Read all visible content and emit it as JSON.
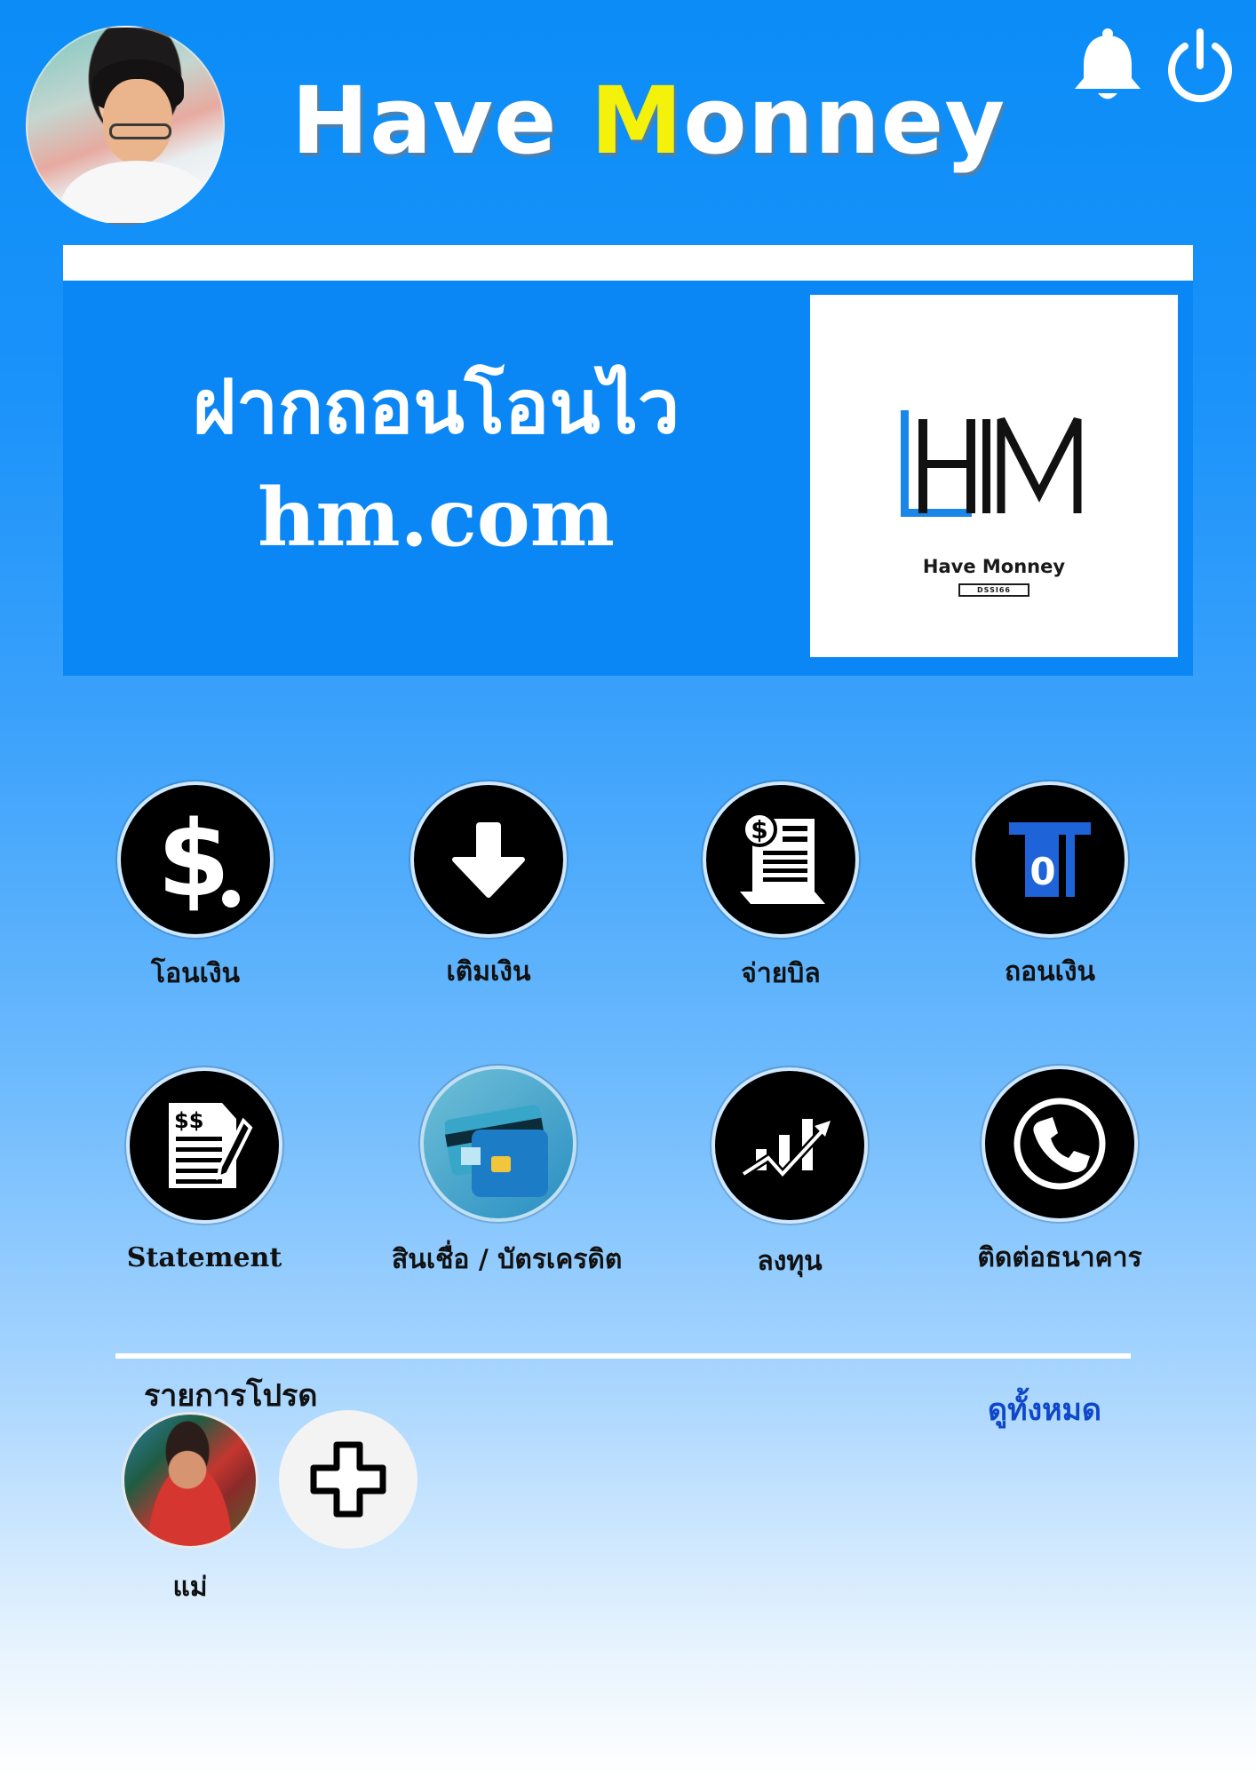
{
  "header": {
    "title_main": "Have ",
    "title_accent": "M",
    "title_rest": "onney",
    "accent_color": "#f4f20a"
  },
  "icons": {
    "notification": "bell-icon",
    "power": "power-icon"
  },
  "banner": {
    "line1": "ฝากถอนโอนไว",
    "line2": "hm.com",
    "background": "#0a87f5",
    "logo": {
      "mark": "HM",
      "name": "Have Monney",
      "sub": "DSSI66"
    }
  },
  "services": [
    {
      "label": "โอนเงิน",
      "icon": "dollar-icon"
    },
    {
      "label": "เติมเงิน",
      "icon": "download-arrow-icon"
    },
    {
      "label": "จ่ายบิล",
      "icon": "bill-receipt-icon"
    },
    {
      "label": "ถอนเงิน",
      "icon": "atm-withdraw-icon"
    },
    {
      "label": "Statement",
      "icon": "statement-document-icon"
    },
    {
      "label": "สินเชื่อ /  บัตรเครดิต",
      "icon": "credit-card-icon"
    },
    {
      "label": "ลงทุน",
      "icon": "investment-chart-icon"
    },
    {
      "label": "ติดต่อธนาคาร",
      "icon": "phone-icon"
    }
  ],
  "favorites": {
    "title": "รายการโปรด",
    "view_all": "ดูทั้งหมด",
    "items": [
      {
        "label": "แม่"
      }
    ],
    "add_icon": "plus-icon"
  }
}
